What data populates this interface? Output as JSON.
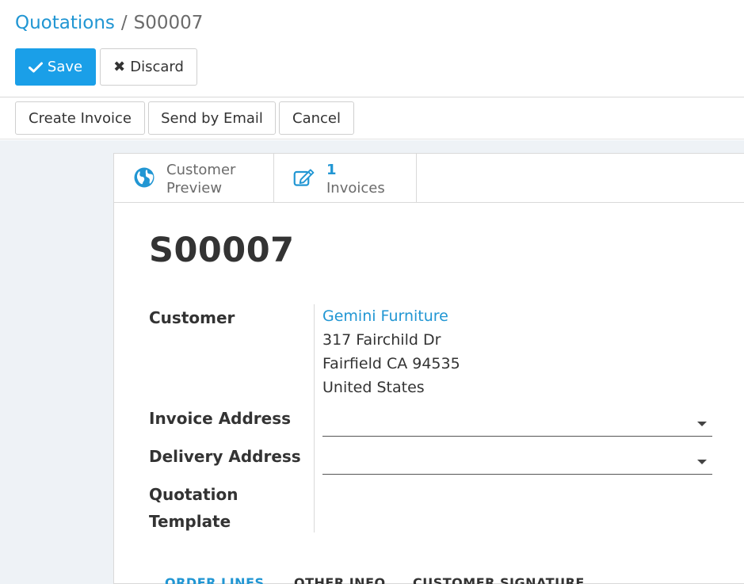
{
  "breadcrumb": {
    "parent": "Quotations",
    "separator": "/",
    "current": "S00007"
  },
  "toolbar": {
    "save_label": "Save",
    "discard_label": "Discard"
  },
  "statusbar": {
    "create_invoice_label": "Create Invoice",
    "send_email_label": "Send by Email",
    "cancel_label": "Cancel"
  },
  "smart_buttons": {
    "preview": {
      "line1": "Customer",
      "line2": "Preview",
      "icon": "globe-icon"
    },
    "invoices": {
      "count": "1",
      "label": "Invoices",
      "icon": "edit-icon"
    }
  },
  "form": {
    "title": "S00007",
    "customer_label": "Customer",
    "customer_name": "Gemini Furniture",
    "customer_address": [
      "317 Fairchild Dr",
      "Fairfield CA 94535",
      "United States"
    ],
    "invoice_address_label": "Invoice Address",
    "invoice_address_value": "",
    "delivery_address_label": "Delivery Address",
    "delivery_address_value": "",
    "quotation_template_label_1": "Quotation",
    "quotation_template_label_2": "Template"
  },
  "tabs": [
    {
      "label": "ORDER LINES"
    },
    {
      "label": "OTHER INFO"
    },
    {
      "label": "CUSTOMER SIGNATURE"
    }
  ],
  "colors": {
    "accent": "#1a9fe8",
    "link": "#2196d3",
    "background": "#eef2f6"
  }
}
